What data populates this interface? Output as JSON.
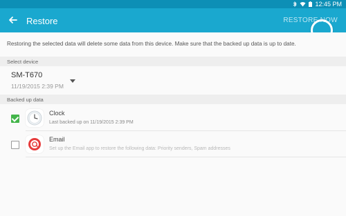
{
  "status_bar": {
    "time": "12:45 PM",
    "icons": [
      "bluetooth-icon",
      "wifi-icon",
      "battery-icon"
    ]
  },
  "app_bar": {
    "title": "Restore",
    "action_label": "RESTORE NOW"
  },
  "notice": "Restoring the selected data will delete some data from this device. Make sure that the backed up data is up to date.",
  "select_device": {
    "label": "Select device",
    "device_name": "SM-T670",
    "device_date": "11/19/2015 2:39 PM"
  },
  "backed_up": {
    "label": "Backed up data",
    "items": [
      {
        "name": "Clock",
        "subtitle": "Last backed up on 11/19/2015 2:39 PM",
        "checked": true,
        "icon": "clock-icon"
      },
      {
        "name": "Email",
        "subtitle": "Set up the Email app to restore the following data: Priority senders, Spam addresses",
        "checked": false,
        "icon": "email-icon"
      }
    ]
  },
  "colors": {
    "status_bar": "#0d8fb6",
    "app_bar": "#1aa8cf",
    "checked": "#43b54a"
  }
}
